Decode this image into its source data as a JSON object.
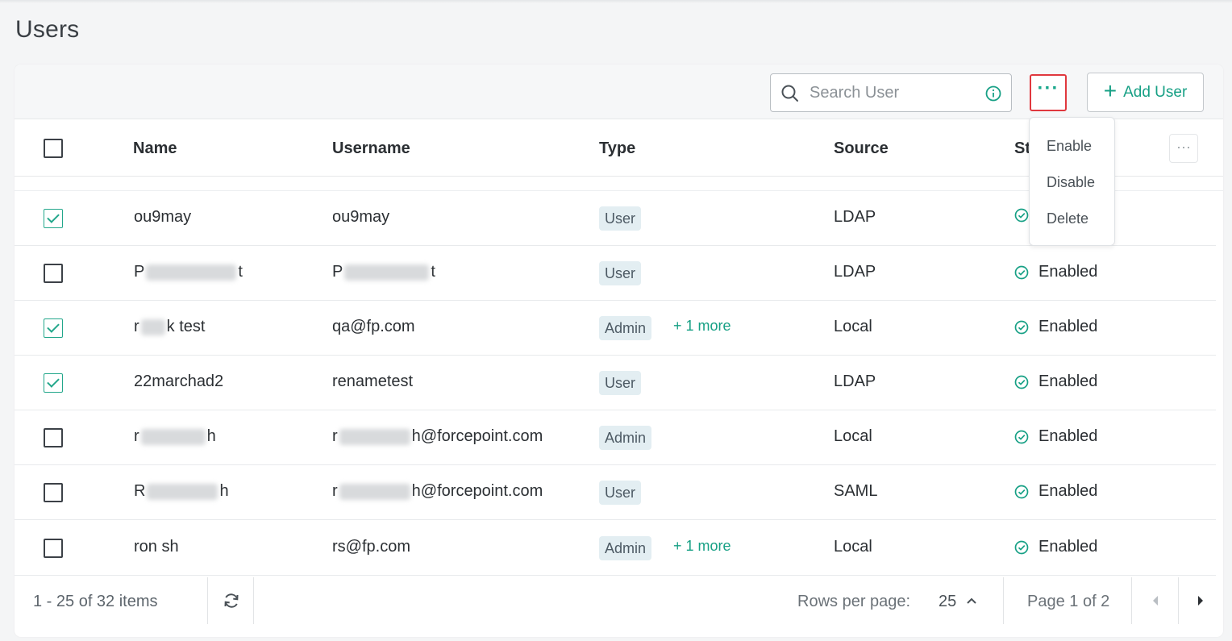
{
  "page": {
    "title": "Users"
  },
  "toolbar": {
    "search_placeholder": "Search User",
    "more_label": "···",
    "add_user_label": "Add User"
  },
  "dropdown": {
    "items": [
      "Enable",
      "Disable",
      "Delete"
    ]
  },
  "table": {
    "columns": {
      "name": "Name",
      "username": "Username",
      "type": "Type",
      "source": "Source",
      "status": "St"
    },
    "head_more_label": "···",
    "rows": [
      {
        "checked": true,
        "name": "ou9may",
        "username": "ou9may",
        "type": "User",
        "extra": "",
        "source": "LDAP",
        "status": ""
      },
      {
        "checked": false,
        "name_pre": "P",
        "name_post": "t",
        "username_pre": "P",
        "username_post": "t",
        "type": "User",
        "extra": "",
        "source": "LDAP",
        "status": "Enabled"
      },
      {
        "checked": true,
        "name_pre": "r",
        "name_post": "k test",
        "username": "qa@fp.com",
        "type": "Admin",
        "extra": "+ 1 more",
        "source": "Local",
        "status": "Enabled"
      },
      {
        "checked": true,
        "name": "22marchad2",
        "username": "renametest",
        "type": "User",
        "extra": "",
        "source": "LDAP",
        "status": "Enabled"
      },
      {
        "checked": false,
        "name_pre": "r",
        "name_post": "h",
        "username_pre": "r",
        "username_post": "h@forcepoint.com",
        "type": "Admin",
        "extra": "",
        "source": "Local",
        "status": "Enabled"
      },
      {
        "checked": false,
        "name_pre": "R",
        "name_post": "h",
        "username_pre": "r",
        "username_post": "h@forcepoint.com",
        "type": "User",
        "extra": "",
        "source": "SAML",
        "status": "Enabled"
      },
      {
        "checked": false,
        "name": "ron sh",
        "username": "rs@fp.com",
        "type": "Admin",
        "extra": "+ 1 more",
        "source": "Local",
        "status": "Enabled"
      }
    ]
  },
  "footer": {
    "range": "1 - 25 of 32 items",
    "rows_per_page_label": "Rows per page:",
    "rows_per_page_value": "25",
    "page_label": "Page 1 of 2"
  },
  "colors": {
    "accent": "#17a085",
    "highlight_border": "#e0383e",
    "badge_bg": "#e3eef2"
  },
  "icons": [
    "search-icon",
    "info-icon",
    "plus-icon",
    "check-circle-icon",
    "refresh-icon",
    "chevron-up-icon",
    "chevron-left-icon",
    "chevron-right-icon"
  ]
}
